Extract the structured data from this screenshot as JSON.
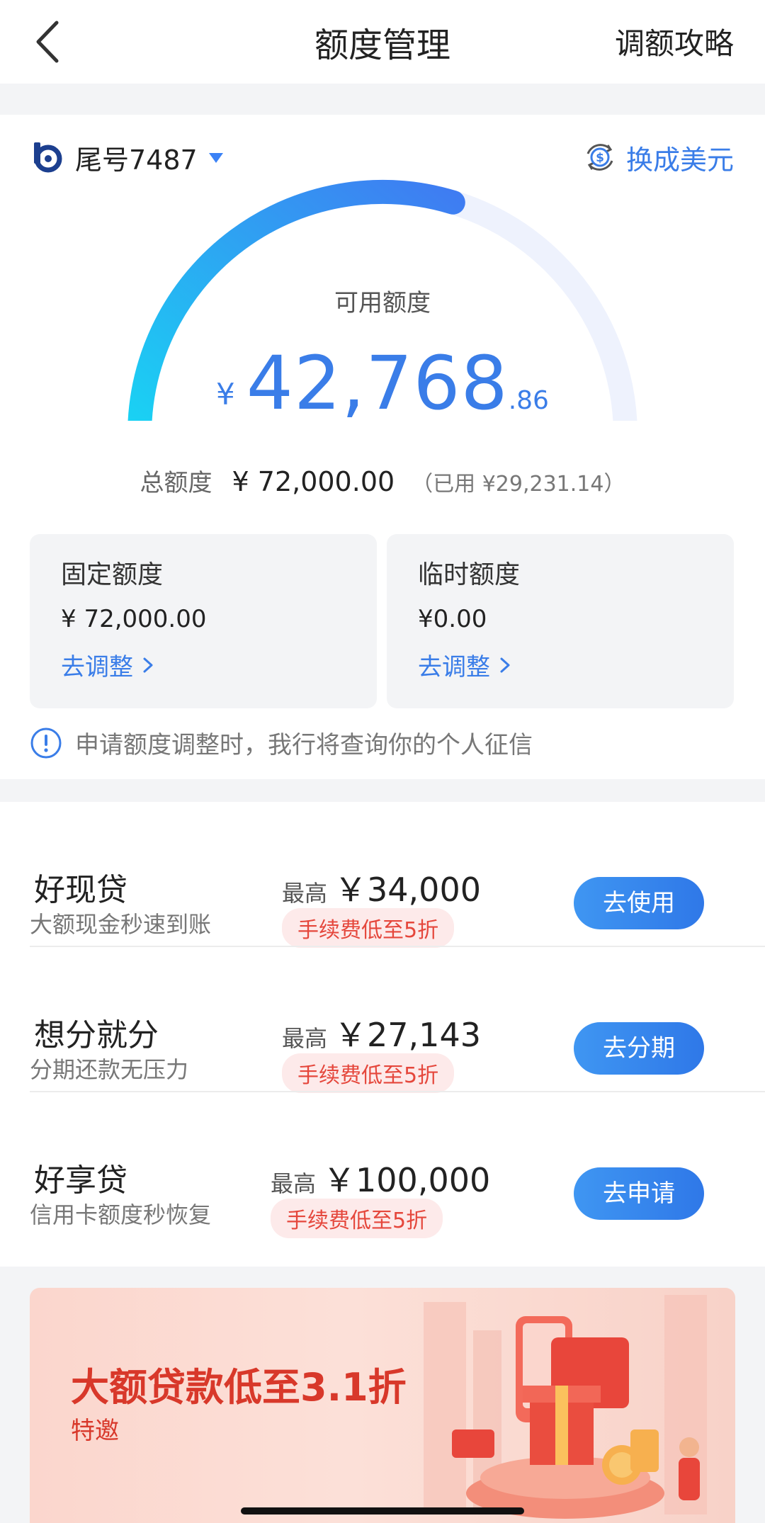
{
  "header": {
    "title": "额度管理",
    "right_link": "调额攻略"
  },
  "card": {
    "tail_label": "尾号7487",
    "currency_switch": "换成美元"
  },
  "gauge": {
    "title": "可用额度",
    "currency": "¥",
    "amount_int": "42,768",
    "amount_dec": ".86",
    "fraction_available": 0.594
  },
  "total": {
    "label": "总额度",
    "value": "¥ 72,000.00",
    "used": "（已用 ¥29,231.14）"
  },
  "quota_cards": [
    {
      "title": "固定额度",
      "value": "¥ 72,000.00",
      "link": "去调整"
    },
    {
      "title": "临时额度",
      "value": "¥0.00",
      "link": "去调整"
    }
  ],
  "notice": "申请额度调整时，我行将查询你的个人征信",
  "loans": [
    {
      "name": "好现贷",
      "desc": "大额现金秒速到账",
      "max_label": "最高",
      "max_value": "￥34,000",
      "tag": "手续费低至5折",
      "button": "去使用"
    },
    {
      "name": "想分就分",
      "desc": "分期还款无压力",
      "max_label": "最高",
      "max_value": "￥27,143",
      "tag": "手续费低至5折",
      "button": "去分期"
    },
    {
      "name": "好享贷",
      "desc": "信用卡额度秒恢复",
      "max_label": "最高",
      "max_value": "￥100,000",
      "tag": "手续费低至5折",
      "button": "去申请"
    }
  ],
  "banner": {
    "title": "大额贷款低至3.1折",
    "subtitle": "特邀"
  },
  "colors": {
    "accent": "#3a7de8",
    "gauge_start": "#19d3f3",
    "gauge_end": "#3f7cf2",
    "gauge_track": "#eef2fd",
    "tag_text": "#e5473c",
    "banner_text": "#d8382a"
  }
}
